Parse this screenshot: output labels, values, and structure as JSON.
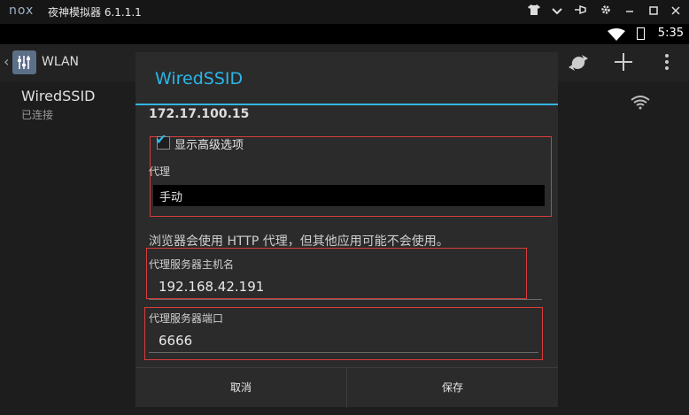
{
  "window": {
    "logo": "nox",
    "title": "夜神模拟器 6.1.1.1"
  },
  "status_bar": {
    "time": "5:35"
  },
  "action_bar": {
    "title": "WLAN"
  },
  "network_list": {
    "items": [
      {
        "ssid": "WiredSSID",
        "status": "已连接"
      }
    ]
  },
  "dialog": {
    "title": "WiredSSID",
    "ip_address": "172.17.100.15",
    "advanced_checkbox_label": "显示高级选项",
    "advanced_checked": true,
    "proxy_label": "代理",
    "proxy_value": "手动",
    "proxy_note": "浏览器会使用 HTTP 代理，但其他应用可能不会使用。",
    "host_label": "代理服务器主机名",
    "host_value": "192.168.42.191",
    "port_label": "代理服务器端口",
    "port_value": "6666",
    "cancel_label": "取消",
    "save_label": "保存"
  },
  "colors": {
    "accent": "#33b5e5",
    "highlight_box": "#d93c3c"
  }
}
